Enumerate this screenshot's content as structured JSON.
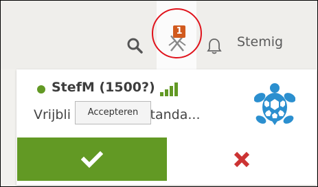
{
  "header": {
    "username": "Stemig",
    "challenge_count": "1",
    "icons": [
      "search-icon",
      "crossed-swords-icon",
      "bell-icon"
    ]
  },
  "challenge": {
    "player": "StefM (1500?)",
    "details": "Vrijbli",
    "details_tail": "60 • Standa...",
    "tooltip": "Accepteren",
    "accept_icon": "checkmark-icon",
    "decline_icon": "x-icon",
    "avatar_icon": "turtle-icon",
    "colors": {
      "accept": "#629924",
      "decline": "#cc3333",
      "online": "#629924",
      "badge": "#d15a1e",
      "highlight": "#e0121b"
    }
  }
}
